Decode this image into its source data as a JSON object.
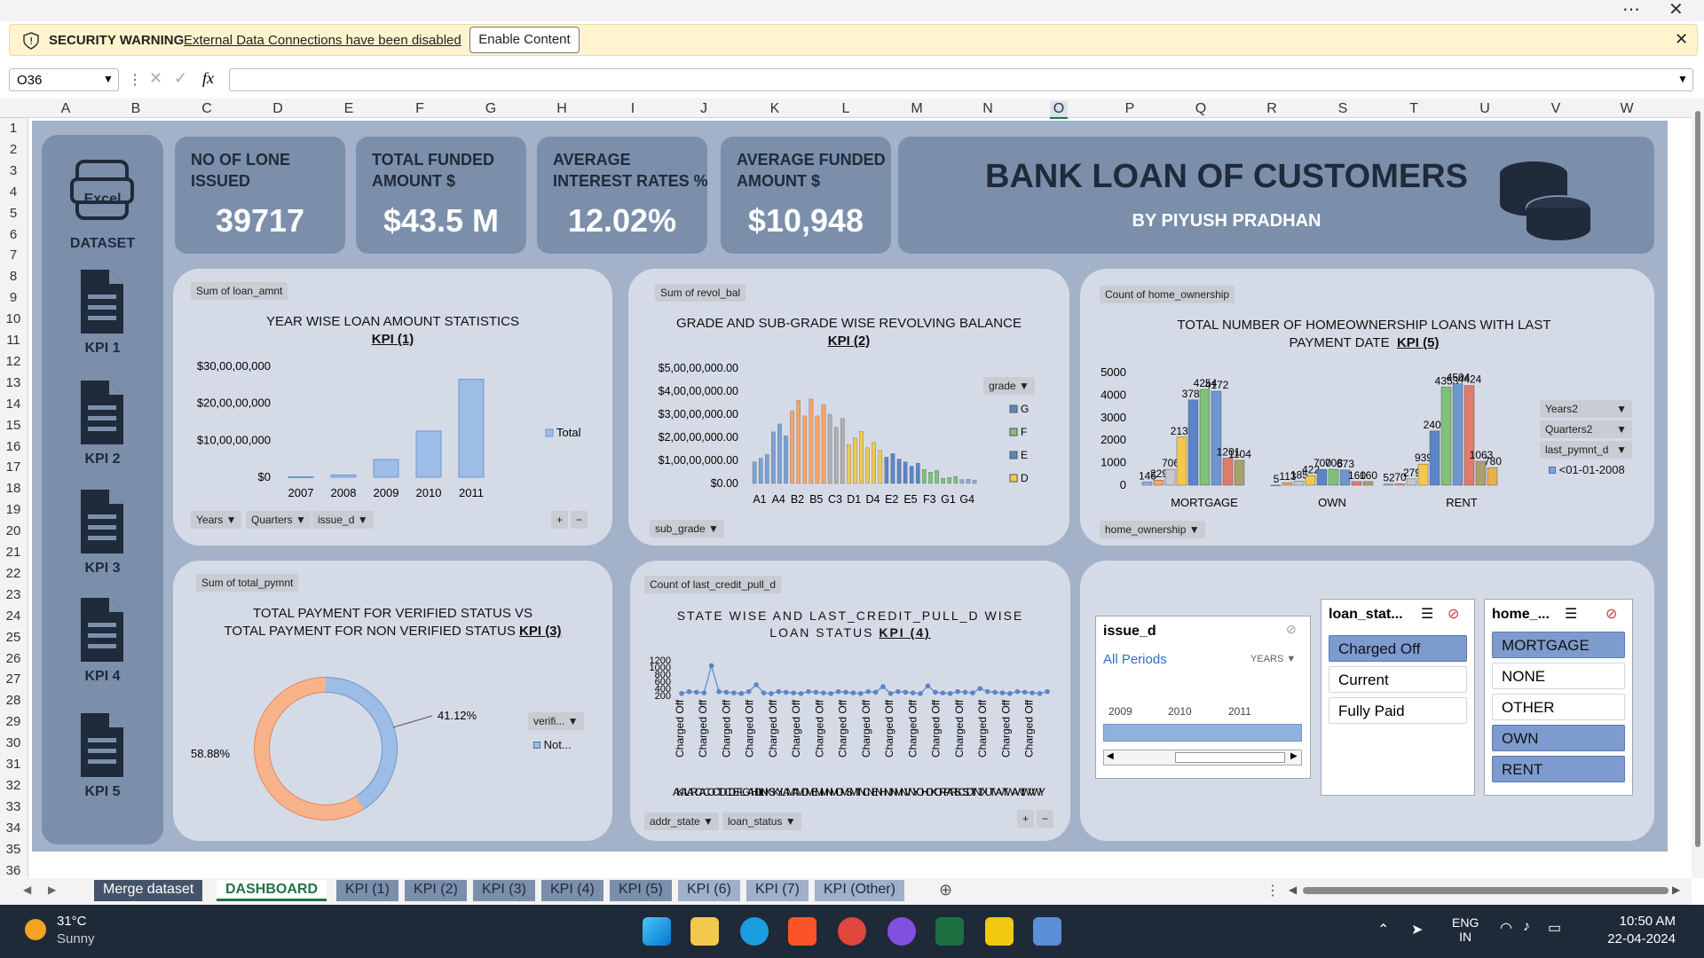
{
  "security": {
    "label": "SECURITY WARNING",
    "message": "External Data Connections have been disabled",
    "button": "Enable Content"
  },
  "formula": {
    "namebox": "O36",
    "fx": "fx"
  },
  "columns": [
    "A",
    "B",
    "C",
    "D",
    "E",
    "F",
    "G",
    "H",
    "I",
    "J",
    "K",
    "L",
    "M",
    "N",
    "O",
    "P",
    "Q",
    "R",
    "S",
    "T",
    "U",
    "V",
    "W"
  ],
  "rows": [
    "1",
    "2",
    "3",
    "4",
    "5",
    "6",
    "7",
    "8",
    "9",
    "10",
    "11",
    "12",
    "13",
    "14",
    "15",
    "16",
    "17",
    "18",
    "19",
    "20",
    "21",
    "22",
    "23",
    "24",
    "25",
    "26",
    "27",
    "28",
    "29",
    "30",
    "31",
    "32",
    "33",
    "34",
    "35",
    "36"
  ],
  "sidebar": {
    "excel_label": "Excel",
    "dataset": "DATASET",
    "kpis": [
      "KPI 1",
      "KPI 2",
      "KPI 3",
      "KPI 4",
      "KPI 5"
    ]
  },
  "cards": [
    {
      "label": "NO OF LONE ISSUED",
      "value": "39717"
    },
    {
      "label": "TOTAL FUNDED AMOUNT $",
      "value": "$43.5 M"
    },
    {
      "label": "AVERAGE INTEREST RATES %",
      "value": "12.02%"
    },
    {
      "label": "AVERAGE FUNDED AMOUNT $",
      "value": "$10,948"
    }
  ],
  "header": {
    "title": "BANK LOAN OF CUSTOMERS",
    "subtitle": "BY PIYUSH PRADHAN"
  },
  "p1": {
    "tag": "Sum of loan_amnt",
    "title": "YEAR WISE LOAN AMOUNT STATISTICS",
    "kpi": "KPI (1)",
    "legend": "Total",
    "yticks": [
      "$30,00,00,000",
      "$20,00,00,000",
      "$10,00,00,000",
      "$0"
    ],
    "dd1": "Years",
    "dd2": "Quarters",
    "dd3": "issue_d"
  },
  "p2": {
    "tag": "Sum of revol_bal",
    "title": "GRADE AND SUB-GRADE WISE REVOLVING BALANCE",
    "kpi": "KPI (2)",
    "yticks": [
      "$5,00,00,000.00",
      "$4,00,00,000.00",
      "$3,00,00,000.00",
      "$2,00,00,000.00",
      "$1,00,00,000.00",
      "$0.00"
    ],
    "xlabels": [
      "A1",
      "A4",
      "B2",
      "B5",
      "C3",
      "D1",
      "D4",
      "E2",
      "E5",
      "F3",
      "G1",
      "G4"
    ],
    "legend_title": "grade",
    "legend": [
      "G",
      "F",
      "E",
      "D"
    ],
    "dd": "sub_grade"
  },
  "p3": {
    "tag": "Count of home_ownership",
    "title": "TOTAL NUMBER OF HOMEOWNERSHIP LOANS WITH LAST PAYMENT DATE",
    "kpi": "KPI (5)",
    "yticks": [
      "5000",
      "4000",
      "3000",
      "2000",
      "1000",
      "0"
    ],
    "groups": [
      "MORTGAGE",
      "OWN",
      "RENT"
    ],
    "dd1": "Years2",
    "dd2": "Quarters2",
    "dd3": "last_pymnt_d",
    "legend": "<01-01-2008",
    "dd_bottom": "home_ownership"
  },
  "p4": {
    "tag": "Sum of total_pymnt",
    "title": "TOTAL PAYMENT FOR VERIFIED STATUS VS",
    "title2": "TOTAL PAYMENT FOR NON VERIFIED STATUS",
    "kpi": "KPI (3)",
    "pct1": "41.12%",
    "pct2": "58.88%",
    "dd": "verifi...",
    "legend": "Not..."
  },
  "p5": {
    "tag": "Count of last_credit_pull_d",
    "title": "STATE WISE AND LAST_CREDIT_PULL_D WISE",
    "title2": "LOAN STATUS",
    "kpi": "KPI (4)",
    "yticks": [
      "1200",
      "1000",
      "800",
      "600",
      "400",
      "200"
    ],
    "xtick": "Charged Off",
    "xlabels": "AKALARCACOCTDCDEFLGAHIIDILINKSKYLAMAMDMEMIMNMOMSMTNCNENHNJNMNVNYOHOKORPARISCSDTNTXUTVAVTWAWIWVWY",
    "dd1": "addr_state",
    "dd2": "loan_status"
  },
  "slicers": {
    "issue": {
      "title": "issue_d",
      "period": "All Periods",
      "unit": "YEARS",
      "years": [
        "2009",
        "2010",
        "2011"
      ]
    },
    "loan": {
      "title": "loan_stat...",
      "items": [
        "Charged Off",
        "Current",
        "Fully Paid"
      ]
    },
    "home": {
      "title": "home_...",
      "items": [
        "MORTGAGE",
        "NONE",
        "OTHER",
        "OWN",
        "RENT"
      ]
    }
  },
  "tabs": [
    "Merge dataset",
    "DASHBOARD",
    "KPI (1)",
    "KPI (2)",
    "KPI (3)",
    "KPI (4)",
    "KPI (5)",
    "KPI (6)",
    "KPI (7)",
    "KPI (Other)"
  ],
  "taskbar": {
    "temp": "31°C",
    "weather": "Sunny",
    "lang1": "ENG",
    "lang2": "IN",
    "time": "10:50 AM",
    "date": "22-04-2024"
  },
  "chart_data": [
    {
      "type": "bar",
      "title": "YEAR WISE LOAN AMOUNT STATISTICS",
      "categories": [
        "2007",
        "2008",
        "2009",
        "2010",
        "2011"
      ],
      "series": [
        {
          "name": "Total",
          "values": [
            1200000,
            6000000,
            48000000,
            125000000,
            265000000
          ]
        }
      ],
      "ylim": [
        0,
        300000000
      ]
    },
    {
      "type": "bar",
      "title": "GRADE AND SUB-GRADE WISE REVOLVING BALANCE",
      "ylim": [
        0,
        500000000
      ]
    },
    {
      "type": "bar",
      "title": "TOTAL NUMBER OF HOMEOWNERSHIP LOANS WITH LAST PAYMENT DATE",
      "categories": [
        "MORTGAGE",
        "OWN",
        "RENT"
      ],
      "series": [
        {
          "name": "MORTGAGE",
          "values": [
            145,
            229,
            706,
            2131,
            3786,
            4254,
            4172,
            1201,
            1104
          ]
        },
        {
          "name": "OWN",
          "values": [
            5,
            113,
            185,
            422,
            700,
            708,
            673,
            160,
            160
          ]
        },
        {
          "name": "RENT",
          "values": [
            52,
            70,
            279,
            939,
            2408,
            4353,
            4504,
            4424,
            1063,
            780
          ]
        }
      ],
      "ylim": [
        0,
        5000
      ]
    },
    {
      "type": "pie",
      "title": "TOTAL PAYMENT FOR VERIFIED STATUS VS TOTAL PAYMENT FOR NON VERIFIED STATUS",
      "values": [
        41.12,
        58.88
      ],
      "labels": [
        "41.12%",
        "58.88%"
      ]
    },
    {
      "type": "line",
      "title": "STATE WISE AND LAST_CREDIT_PULL_D WISE LOAN STATUS",
      "ylim": [
        0,
        1200
      ]
    }
  ]
}
